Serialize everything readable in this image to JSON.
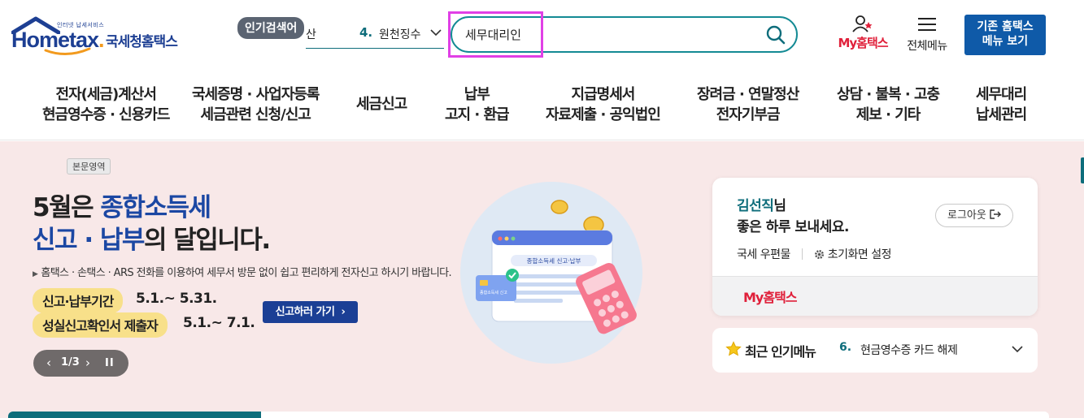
{
  "header": {
    "logo_small": "인터넷 납세서비스",
    "logo_main": "Hometax",
    "logo_dot": ".",
    "logo_kr": "국세청홈택스",
    "popular": {
      "badge": "인기검색어",
      "prev_text": "산",
      "rank": "4.",
      "item": "원천징수"
    },
    "search": {
      "value": "세무대리인",
      "placeholder": ""
    },
    "my_hometax_label": "My홈택스",
    "all_menu_label": "전체메뉴",
    "legacy_button": {
      "line1": "기존 홈택스",
      "line2": "메뉴 보기"
    },
    "colors": {
      "brand": "#1d3f93",
      "accent": "#0e6d7b",
      "red": "#e0203a",
      "highlight": "#e040e6"
    }
  },
  "nav": [
    {
      "line1": "전자(세금)계산서",
      "line2": "현금영수증 · 신용카드"
    },
    {
      "line1": "국세증명 · 사업자등록",
      "line2": "세금관련 신청/신고"
    },
    {
      "line1": "세금신고",
      "line2": ""
    },
    {
      "line1": "납부",
      "line2": "고지 · 환급"
    },
    {
      "line1": "지급명세서",
      "line2": "자료제출 · 공익법인"
    },
    {
      "line1": "장려금 · 연말정산",
      "line2": "전자기부금"
    },
    {
      "line1": "상담 · 불복 · 고충",
      "line2": "제보 · 기타"
    },
    {
      "line1": "세무대리",
      "line2": "납세관리"
    }
  ],
  "hero": {
    "section_tag": "본문영역",
    "title_pre": "5월은 ",
    "title_hl1": "종합소득세",
    "title_hl2": "신고 · 납부",
    "title_post": "의 달입니다.",
    "desc": "홈택스 · 손택스 · ARS 전화를 이용하여 세무서 방문 없이 쉽고 편리하게 전자신고 하시기 바랍니다.",
    "period1_label": "신고·납부기간",
    "period1_date": "5.1.~ 5.31.",
    "period2_label": "성실신고확인서 제출자",
    "period2_date": "5.1.~ 7.1.",
    "file_button": "신고하러 가기",
    "slide": {
      "prev": "‹",
      "count": "1/3",
      "next": "›",
      "pause": "II"
    },
    "illustration": {
      "window_label": "종합소득세 신고·납부",
      "card_label": "종합소득세 신고"
    }
  },
  "user": {
    "name": "김선직",
    "suffix": "님",
    "greeting": "좋은 하루 보내세요.",
    "logout": "로그아웃",
    "link_mail": "국세 우편물",
    "link_settings": "초기화면 설정",
    "my_hometax": "My홈택스"
  },
  "recent": {
    "title": "최근 인기메뉴",
    "rank": "6.",
    "item": "현금영수증 카드 해제"
  }
}
